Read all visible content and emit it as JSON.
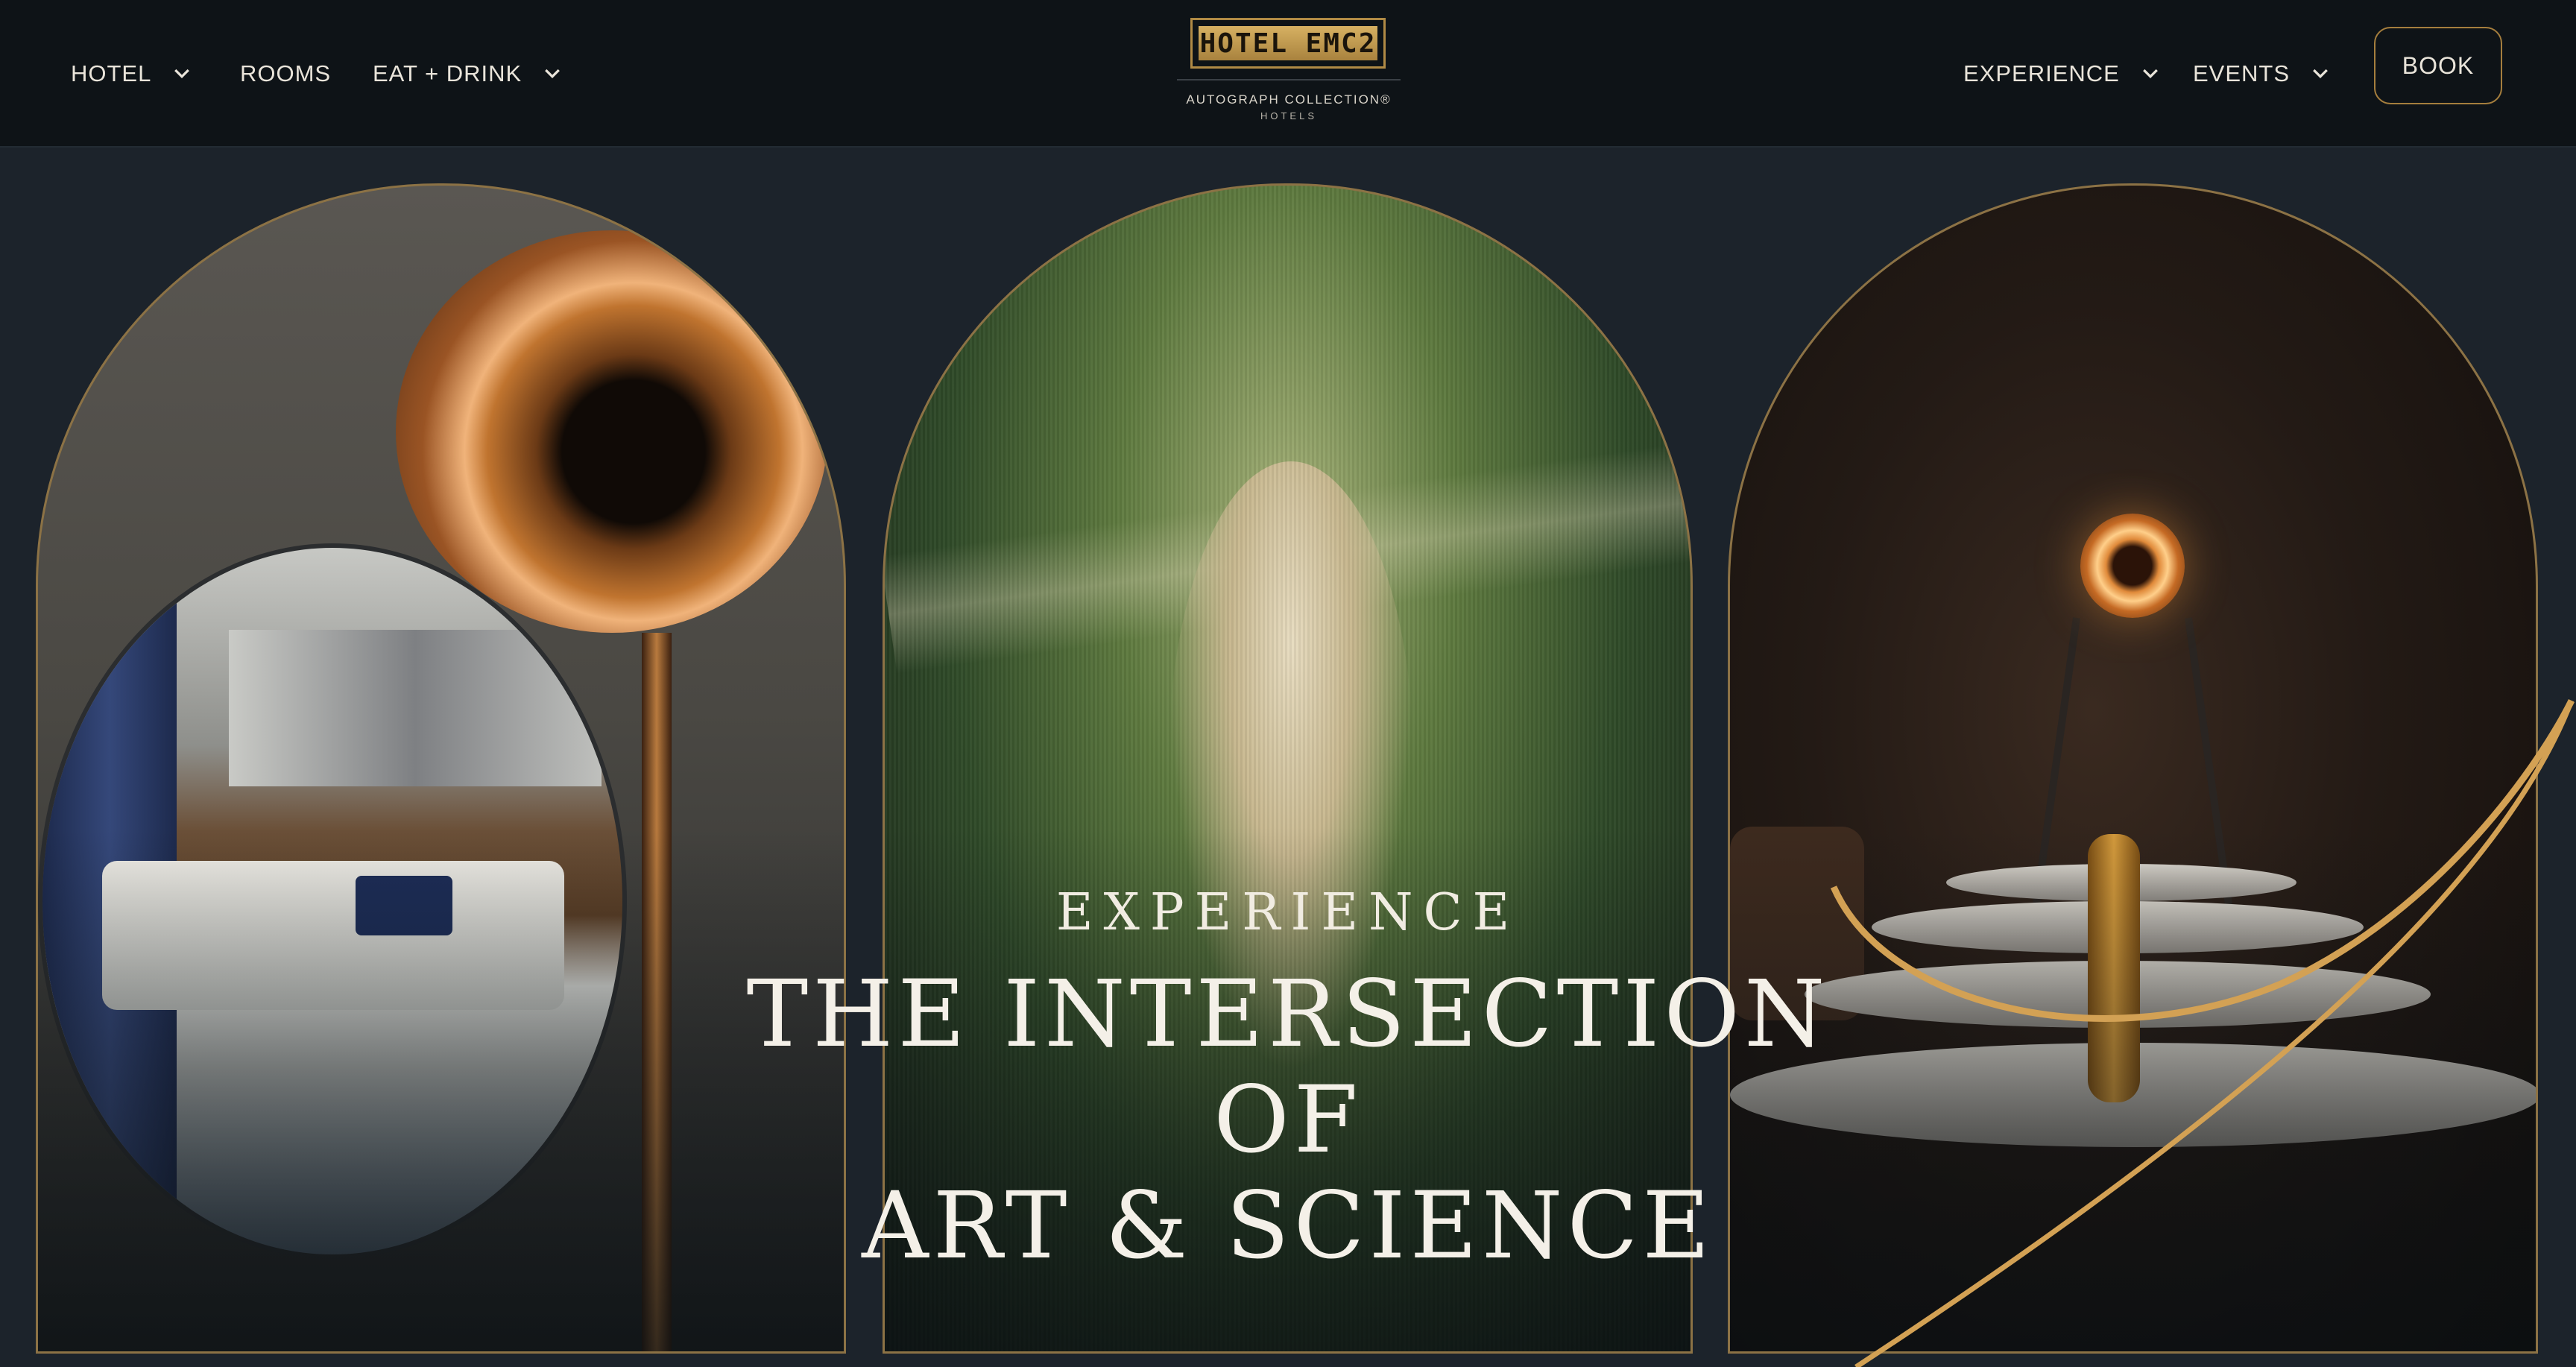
{
  "nav": {
    "left_items": [
      {
        "label": "HOTEL",
        "has_dropdown": true
      },
      {
        "label": "ROOMS",
        "has_dropdown": false
      },
      {
        "label": "EAT + DRINK",
        "has_dropdown": true
      }
    ],
    "right_items": [
      {
        "label": "EXPERIENCE",
        "has_dropdown": true
      },
      {
        "label": "EVENTS",
        "has_dropdown": true
      }
    ],
    "book_label": "BOOK"
  },
  "logo": {
    "name": "HOTEL EMC2",
    "subtitle": "AUTOGRAPH COLLECTION®",
    "subtitle2": "HOTELS"
  },
  "hero": {
    "eyebrow": "EXPERIENCE",
    "title_line1": "THE INTERSECTION OF",
    "title_line2": "ART & SCIENCE"
  },
  "colors": {
    "header_bg": "#0e1317",
    "page_bg": "#1c232b",
    "accent_gold": "#b08a45",
    "text_light": "#e9e4da"
  },
  "icons": {
    "dropdown": "chevron-down-icon"
  }
}
